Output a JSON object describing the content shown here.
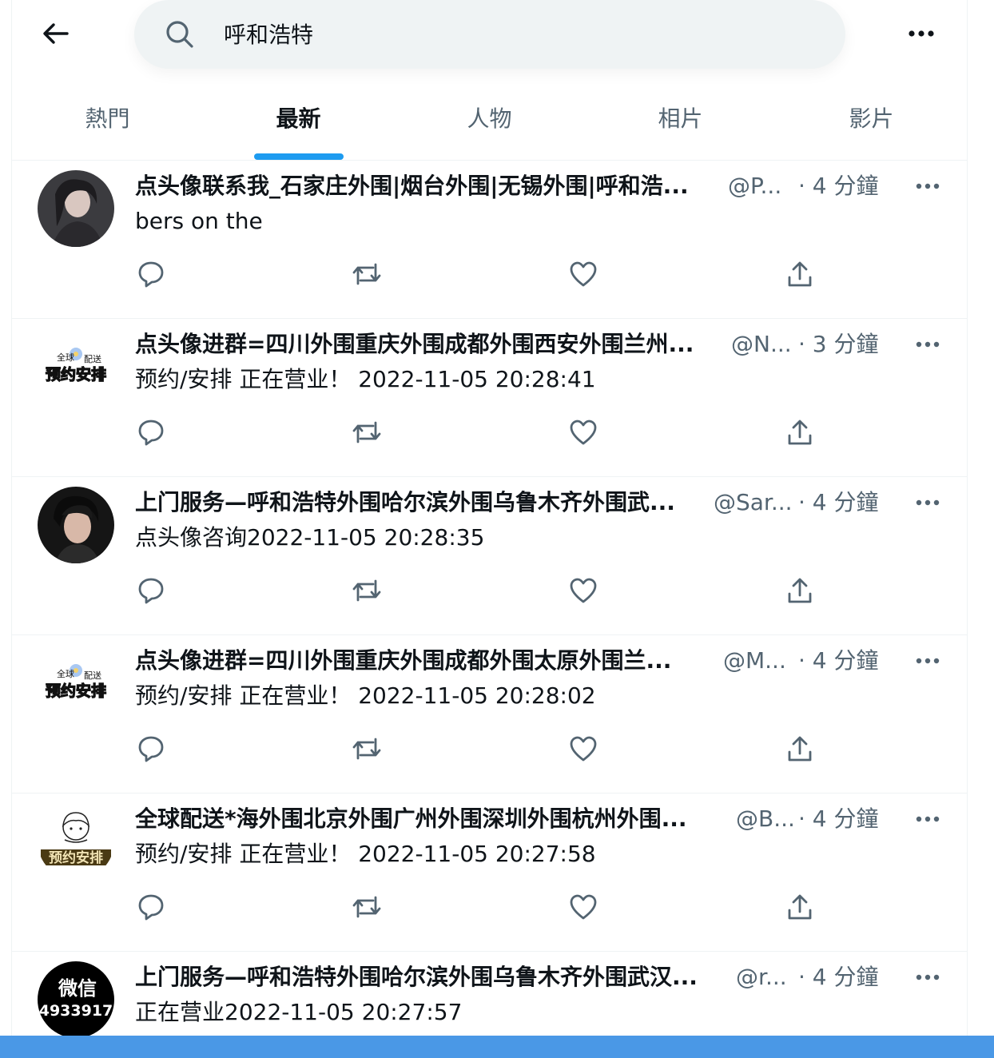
{
  "search": {
    "query": "呼和浩特"
  },
  "tabs": [
    {
      "label": "熱門"
    },
    {
      "label": "最新"
    },
    {
      "label": "人物"
    },
    {
      "label": "相片"
    },
    {
      "label": "影片"
    }
  ],
  "active_tab": "最新",
  "colors": {
    "accent": "#1d9bf0",
    "secondary_text": "#536471",
    "bottom_bar": "#4a98e6"
  },
  "tweets": [
    {
      "title": "点头像联系我_石家庄外围|烟台外围|无锡外围|呼和浩...",
      "handle": "@P...",
      "time": "· 4 分鐘",
      "body": "bers on the",
      "avatar": "photo-woman"
    },
    {
      "title": "点头像进群=四川外围重庆外围成都外围西安外围兰州...",
      "handle": "@N...",
      "time": "· 3 分鐘",
      "body": "预约/安排 正在营业！ 2022-11-05 20:28:41",
      "avatar": "logo-text",
      "avatar_text": [
        "全球",
        "配送",
        "预约安排"
      ]
    },
    {
      "title": "上门服务—呼和浩特外围哈尔滨外围乌鲁木齐外围武...",
      "handle": "@Sar...",
      "time": "· 4 分鐘",
      "body": "点头像咨询2022-11-05 20:28:35",
      "avatar": "photo-man"
    },
    {
      "title": "点头像进群=四川外围重庆外围成都外围太原外围兰...",
      "handle": "@M...",
      "time": "· 4 分鐘",
      "body": "预约/安排 正在营业！ 2022-11-05 20:28:02",
      "avatar": "logo-text",
      "avatar_text": [
        "全球",
        "配送",
        "预约安排"
      ]
    },
    {
      "title": "全球配送*海外围北京外围广州外围深圳外围杭州外围...",
      "handle": "@B...",
      "time": "· 4 分鐘",
      "body": "预约/安排 正在营业！ 2022-11-05 20:27:58",
      "avatar": "cartoon-logo",
      "avatar_text": [
        "预约安排"
      ]
    },
    {
      "title": "上门服务—呼和浩特外围哈尔滨外围乌鲁木齐外围武汉...",
      "handle": "@r...",
      "time": "· 4 分鐘",
      "body": "正在营业2022-11-05 20:27:57",
      "avatar": "wechat-black",
      "avatar_text": [
        "微信",
        "4933917"
      ]
    }
  ],
  "icons": [
    "back-arrow-icon",
    "search-icon",
    "more-icon",
    "reply-icon",
    "retweet-icon",
    "like-icon",
    "share-icon"
  ]
}
